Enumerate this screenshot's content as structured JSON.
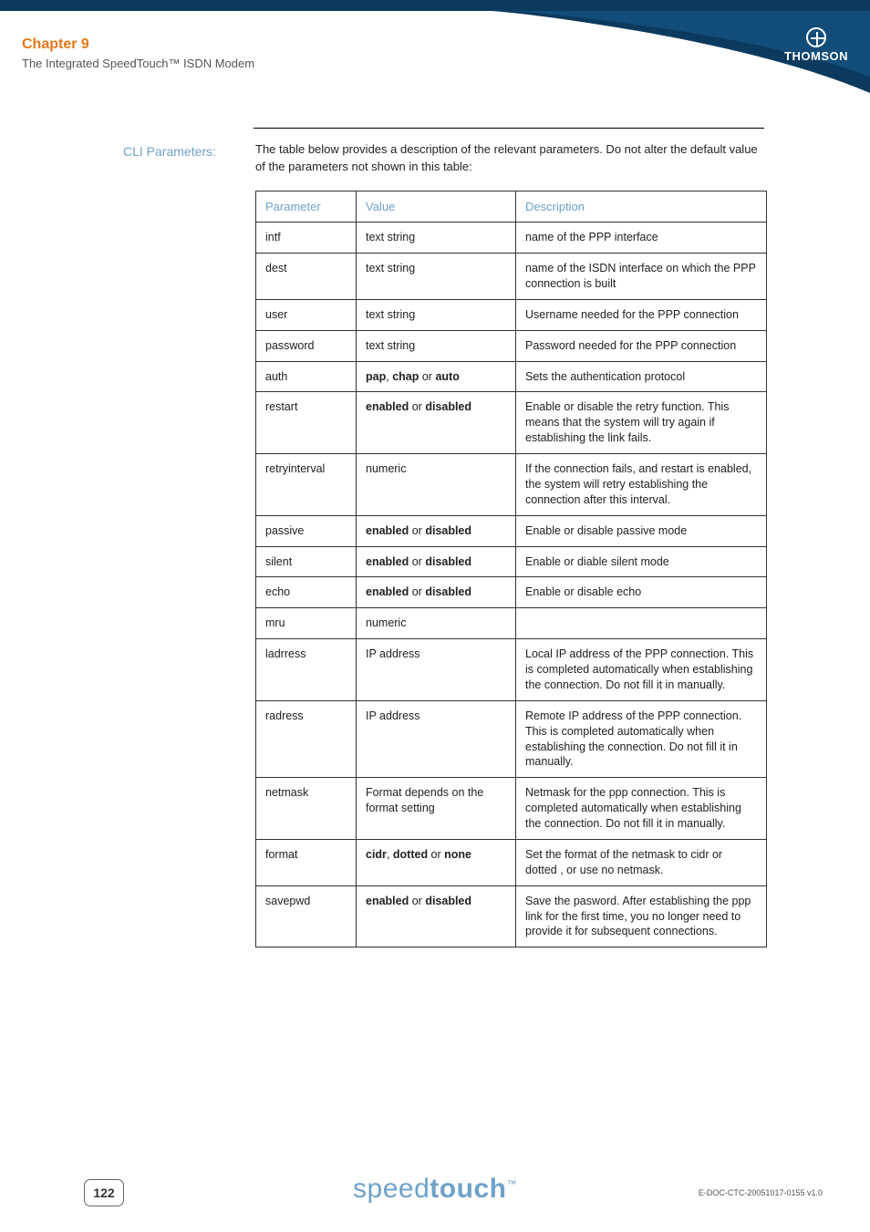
{
  "brand": {
    "name": "THOMSON"
  },
  "header": {
    "chapter": "Chapter 9",
    "subtitle": "The Integrated SpeedTouch™ ISDN Modem"
  },
  "section": {
    "label": "CLI Parameters:",
    "intro": "The table below provides a description of the relevant parameters. Do not alter the default value of the parameters not shown in this table:"
  },
  "table": {
    "headers": {
      "param": "Parameter",
      "value": "Value",
      "desc": "Description"
    },
    "rows": [
      {
        "param": "intf",
        "value": {
          "plain": "text string"
        },
        "desc": "name of the PPP interface"
      },
      {
        "param": "dest",
        "value": {
          "plain": "text string"
        },
        "desc": "name of the ISDN interface on which the PPP connection is built"
      },
      {
        "param": "user",
        "value": {
          "plain": "text string"
        },
        "desc": "Username needed for the PPP connection"
      },
      {
        "param": "password",
        "value": {
          "plain": "text string"
        },
        "desc": "Password needed for the PPP connection"
      },
      {
        "param": "auth",
        "value": {
          "b1": "pap",
          "s1": ", ",
          "b2": "chap",
          "s2": " or ",
          "b3": "auto"
        },
        "desc": "Sets the authentication protocol"
      },
      {
        "param": "restart",
        "value": {
          "b1": "enabled",
          "s1": " or ",
          "b2": "disabled"
        },
        "desc": "Enable or disable the retry function. This means that the system will try again if establishing the link fails."
      },
      {
        "param": "retryinterval",
        "value": {
          "plain": "numeric"
        },
        "desc": "If the connection fails, and restart is enabled, the system will retry establishing the connection after this interval."
      },
      {
        "param": "passive",
        "value": {
          "b1": "enabled",
          "s1": " or ",
          "b2": "disabled"
        },
        "desc": "Enable or disable passive mode"
      },
      {
        "param": "silent",
        "value": {
          "b1": "enabled",
          "s1": " or ",
          "b2": "disabled"
        },
        "desc": "Enable or diable silent mode"
      },
      {
        "param": "echo",
        "value": {
          "b1": "enabled",
          "s1": " or ",
          "b2": "disabled"
        },
        "desc": "Enable or disable echo"
      },
      {
        "param": "mru",
        "value": {
          "plain": "numeric"
        },
        "desc": ""
      },
      {
        "param": "ladrress",
        "value": {
          "plain": "IP address"
        },
        "desc": "Local IP address of the PPP connection. This is completed automatically when establishing the connection. Do not fill it in manually."
      },
      {
        "param": "radress",
        "value": {
          "plain": "IP address"
        },
        "desc": "Remote IP address of the PPP connection. This is completed automatically when establishing the connection. Do not fill it in manually."
      },
      {
        "param": "netmask",
        "value": {
          "plain": "Format depends on the format setting"
        },
        "desc": "Netmask for the ppp connection. This is completed automatically when establishing the connection. Do not fill it in manually."
      },
      {
        "param": "format",
        "value": {
          "b1": "cidr",
          "s1": ", ",
          "b2": "dotted",
          "s2": " or ",
          "b3": "none"
        },
        "desc": "Set the format of the netmask to cidr or dotted , or use no netmask."
      },
      {
        "param": "savepwd",
        "value": {
          "b1": "enabled",
          "s1": " or ",
          "b2": "disabled"
        },
        "desc": "Save the pasword. After establishing the ppp link for the first time, you no longer need to provide it for subsequent connections."
      }
    ]
  },
  "footer": {
    "page": "122",
    "logo": {
      "part1": "speed",
      "part2": "touch",
      "tm": "™"
    },
    "docid": "E-DOC-CTC-20051017-0155 v1.0"
  }
}
